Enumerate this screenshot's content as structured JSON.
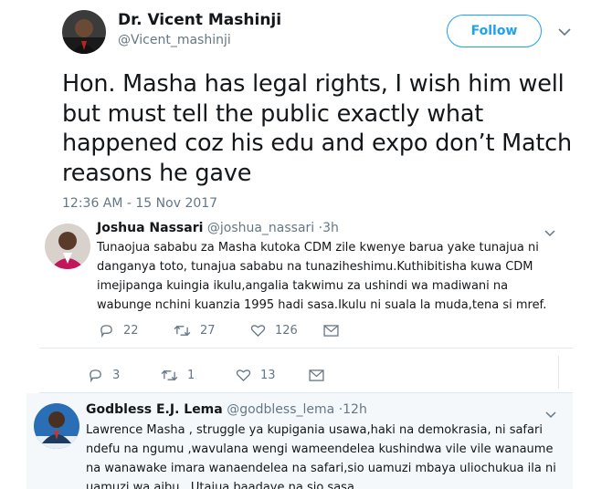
{
  "author": {
    "name": "Dr. Vicent Mashinji",
    "handle": "@Vicent_mashinji",
    "follow_label": "Follow"
  },
  "tweet": {
    "text": "Hon. Masha has legal rights, I wish him well but must tell the public exactly what happened coz his edu and expo don’t Match reasons he gave",
    "timestamp": "12:36 AM - 15 Nov 2017",
    "replies": "3",
    "retweets": "1",
    "likes": "13"
  },
  "quoted": {
    "name": "Joshua Nassari",
    "handle": "@joshua_nassari",
    "time": "·3h",
    "text": "Tunaojua sababu za Masha kutoka CDM zile kwenye barua yake tunajua ni danganya toto, tunajua sababu na tunaziheshimu.Kuthibitisha kuwa CDM imejipanga kuingia ikulu,angalia takwimu za ushindi wa madiwani na wabunge nchini kuanzia 1995 hadi sasa.Ikulu ni suala la muda,tena si mref.",
    "replies": "22",
    "retweets": "27",
    "likes": "126"
  },
  "reply": {
    "name": "Godbless E.J. Lema",
    "handle": "@godbless_lema",
    "time": "·12h",
    "text": "Lawrence Masha , struggle ya kupigania usawa,haki na demokrasia, ni safari ndefu na ngumu ,wavulana wengi wameendelea kushindwa  vile vile wanaume na wanawake imara wanaendelea na safari,sio uamuzi mbaya uliochukua  ila ni uamuzi wa aibu . Utajua baadaye na sio sasa"
  },
  "colors": {
    "accent": "#1da1f2",
    "text_primary": "#14171a",
    "text_secondary": "#657786",
    "border": "#e1e8ed",
    "reply_background": "#f5f8fa"
  },
  "icons": [
    "reply-icon",
    "retweet-icon",
    "like-icon",
    "message-icon",
    "chevron-down-icon"
  ]
}
